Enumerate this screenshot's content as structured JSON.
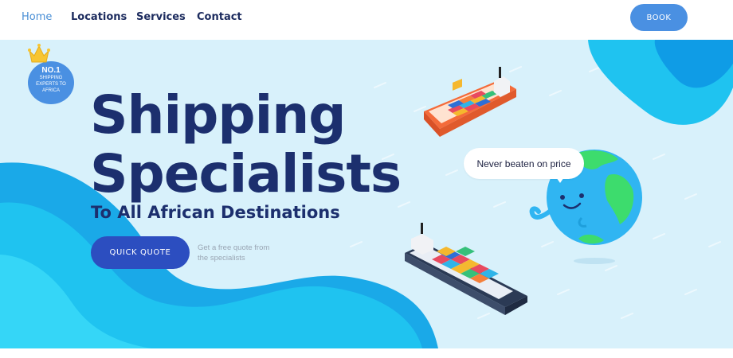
{
  "nav": {
    "items": [
      {
        "label": "Home",
        "active": true
      },
      {
        "label": "Locations",
        "active": false
      },
      {
        "label": "Services",
        "active": false
      },
      {
        "label": "Contact",
        "active": false
      }
    ],
    "book_label": "BOOK"
  },
  "badge": {
    "rank": "NO.1",
    "text": "SHIPPING EXPERTS TO AFRICA",
    "icon": "crown-icon"
  },
  "hero": {
    "title_line1": "Shipping",
    "title_line2": "Specialists",
    "subtitle": "To All African Destinations",
    "cta_label": "QUICK QUOTE",
    "cta_note": "Get a free quote from the specialists",
    "bubble_text": "Never beaten on price"
  },
  "colors": {
    "navy": "#1c2f6e",
    "accent_blue": "#4a90e2",
    "cta_blue": "#2c4ec0",
    "hero_bg": "#d8f1fb",
    "wave": "#1fc3f0",
    "globe_ocean": "#30b5f2",
    "globe_land": "#3ddc6d"
  }
}
